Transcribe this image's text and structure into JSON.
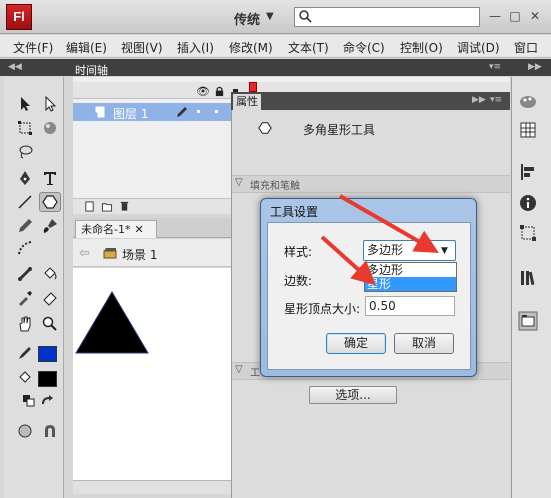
{
  "app": {
    "logo": "Fl",
    "workspace": "传统",
    "window_buttons": {
      "minimize": "—",
      "maximize": "□",
      "close": "✕"
    }
  },
  "menu": [
    "文件(F)",
    "编辑(E)",
    "视图(V)",
    "插入(I)",
    "修改(M)",
    "文本(T)",
    "命令(C)",
    "控制(O)",
    "调试(D)",
    "窗口"
  ],
  "timeline": {
    "tab": "时间轴",
    "layer_name": "图层 1",
    "playhead_frame": "1"
  },
  "document": {
    "tab": "未命名-1*",
    "scene": "场景 1",
    "scene_back_arrow": "⇦"
  },
  "properties": {
    "tab": "属性",
    "tool_name": "多角星形工具",
    "section_fill": "填充和笔触",
    "section_tool": "工",
    "options_button": "选项...",
    "collapse_arrow": "▽"
  },
  "dialog": {
    "title": "工具设置",
    "style_label": "样式:",
    "style_value": "多边形",
    "style_options": [
      "多边形",
      "星形"
    ],
    "highlighted_option": "星形",
    "sides_label": "边数:",
    "star_point_label": "星形顶点大小:",
    "star_point_value": "0.50",
    "ok": "确定",
    "cancel": "取消"
  },
  "colors": {
    "stroke_swatch": "#0033cc",
    "fill_swatch": "#000000",
    "annotation_arrow": "#e8392f",
    "dropdown_highlight": "#3399ff"
  }
}
